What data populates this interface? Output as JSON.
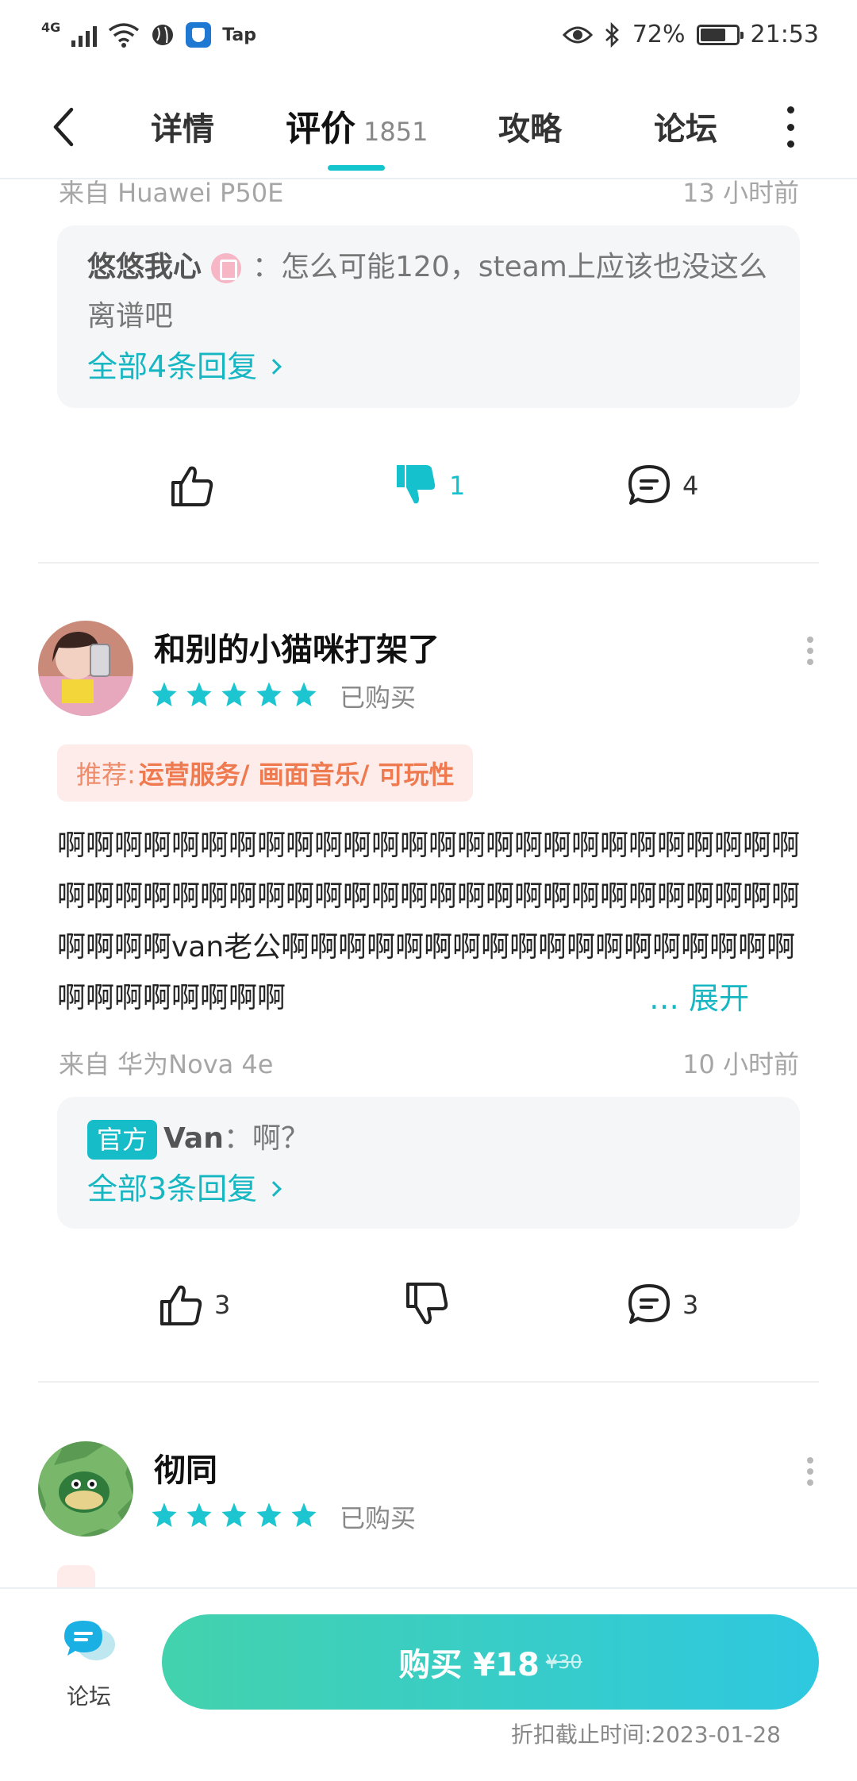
{
  "status_bar": {
    "network": "4G",
    "app_badge": "Tap",
    "battery": "72%",
    "battery_level": 0.72,
    "time": "21:53"
  },
  "nav": {
    "tabs": [
      {
        "label": "详情"
      },
      {
        "label": "评价",
        "count": "1851"
      },
      {
        "label": "攻略"
      },
      {
        "label": "论坛"
      }
    ],
    "active_tab": "评价"
  },
  "review_prev": {
    "device": "来自 Huawei P50E",
    "time": "13 小时前",
    "reply": {
      "user": "悠悠我心",
      "text": "：怎么可能120，steam上应该也没这么离谱吧",
      "all_label": "全部4条回复"
    },
    "actions": {
      "like_count": "",
      "dislike_count": "1",
      "comment_count": "4"
    }
  },
  "review_main": {
    "username": "和别的小猫咪打架了",
    "rating": 5,
    "purchased": "已购买",
    "recommend_label": "推荐:",
    "recommend_items": "运营服务/ 画面音乐/ 可玩性",
    "text": "啊啊啊啊啊啊啊啊啊啊啊啊啊啊啊啊啊啊啊啊啊啊啊啊啊啊啊啊啊啊啊啊啊啊啊啊啊啊啊啊啊啊啊啊啊啊啊啊啊啊啊啊啊啊啊啊van老公啊啊啊啊啊啊啊啊啊啊啊啊啊啊啊啊啊啊啊啊啊啊啊啊啊啊",
    "expand_label": "… 展开",
    "device": "来自 华为Nova 4e",
    "time": "10 小时前",
    "reply": {
      "official_badge": "官方",
      "user": "Van",
      "text": "：啊？",
      "all_label": "全部3条回复"
    },
    "actions": {
      "like_count": "3",
      "dislike_count": "",
      "comment_count": "3"
    }
  },
  "review_next": {
    "username": "彻同",
    "rating": 5,
    "purchased": "已购买"
  },
  "bottom_bar": {
    "forum_label": "论坛",
    "buy_label": "购买 ¥18",
    "old_price": "¥30",
    "deadline": "折扣截止时间:2023-01-28"
  },
  "colors": {
    "accent": "#16b7c2",
    "recommend_bg": "#fdecea",
    "recommend_text": "#ef7a50"
  }
}
